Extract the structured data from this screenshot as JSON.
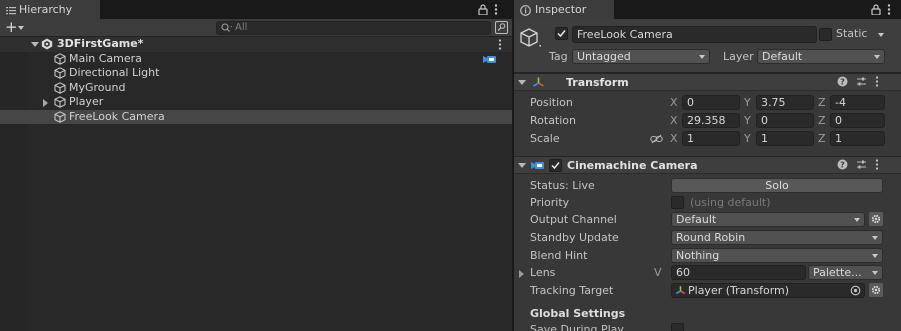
{
  "hierarchy": {
    "tab_label": "Hierarchy",
    "add_label": "+",
    "search_placeholder": "All",
    "scene_name": "3DFirstGame*",
    "items": [
      {
        "label": "Main Camera"
      },
      {
        "label": "Directional Light"
      },
      {
        "label": "MyGround"
      },
      {
        "label": "Player"
      },
      {
        "label": "FreeLook Camera"
      }
    ]
  },
  "inspector": {
    "tab_label": "Inspector",
    "object_name": "FreeLook Camera",
    "static_label": "Static",
    "tag_label": "Tag",
    "tag_value": "Untagged",
    "layer_label": "Layer",
    "layer_value": "Default",
    "transform": {
      "title": "Transform",
      "position_label": "Position",
      "rotation_label": "Rotation",
      "scale_label": "Scale",
      "axis_x": "X",
      "axis_y": "Y",
      "axis_z": "Z",
      "position": {
        "x": "0",
        "y": "3.75",
        "z": "-4"
      },
      "rotation": {
        "x": "29.358",
        "y": "0",
        "z": "0"
      },
      "scale": {
        "x": "1",
        "y": "1",
        "z": "1"
      }
    },
    "cinemachine": {
      "title": "Cinemachine Camera",
      "status_label": "Status: Live",
      "solo_label": "Solo",
      "priority_label": "Priority",
      "priority_hint": "(using default)",
      "output_channel_label": "Output Channel",
      "output_channel_value": "Default",
      "standby_label": "Standby Update",
      "standby_value": "Round Robin",
      "blend_hint_label": "Blend Hint",
      "blend_hint_value": "Nothing",
      "lens_label": "Lens",
      "lens_v": "V",
      "lens_value": "60",
      "lens_preset": "Palette...",
      "tracking_label": "Tracking Target",
      "tracking_value": "Player (Transform)",
      "global_settings_label": "Global Settings",
      "save_during_play_label": "Save During Play"
    }
  },
  "colors": {
    "accent_blue": "#3f8fd6",
    "selection": "#464646",
    "panel": "#383838"
  }
}
